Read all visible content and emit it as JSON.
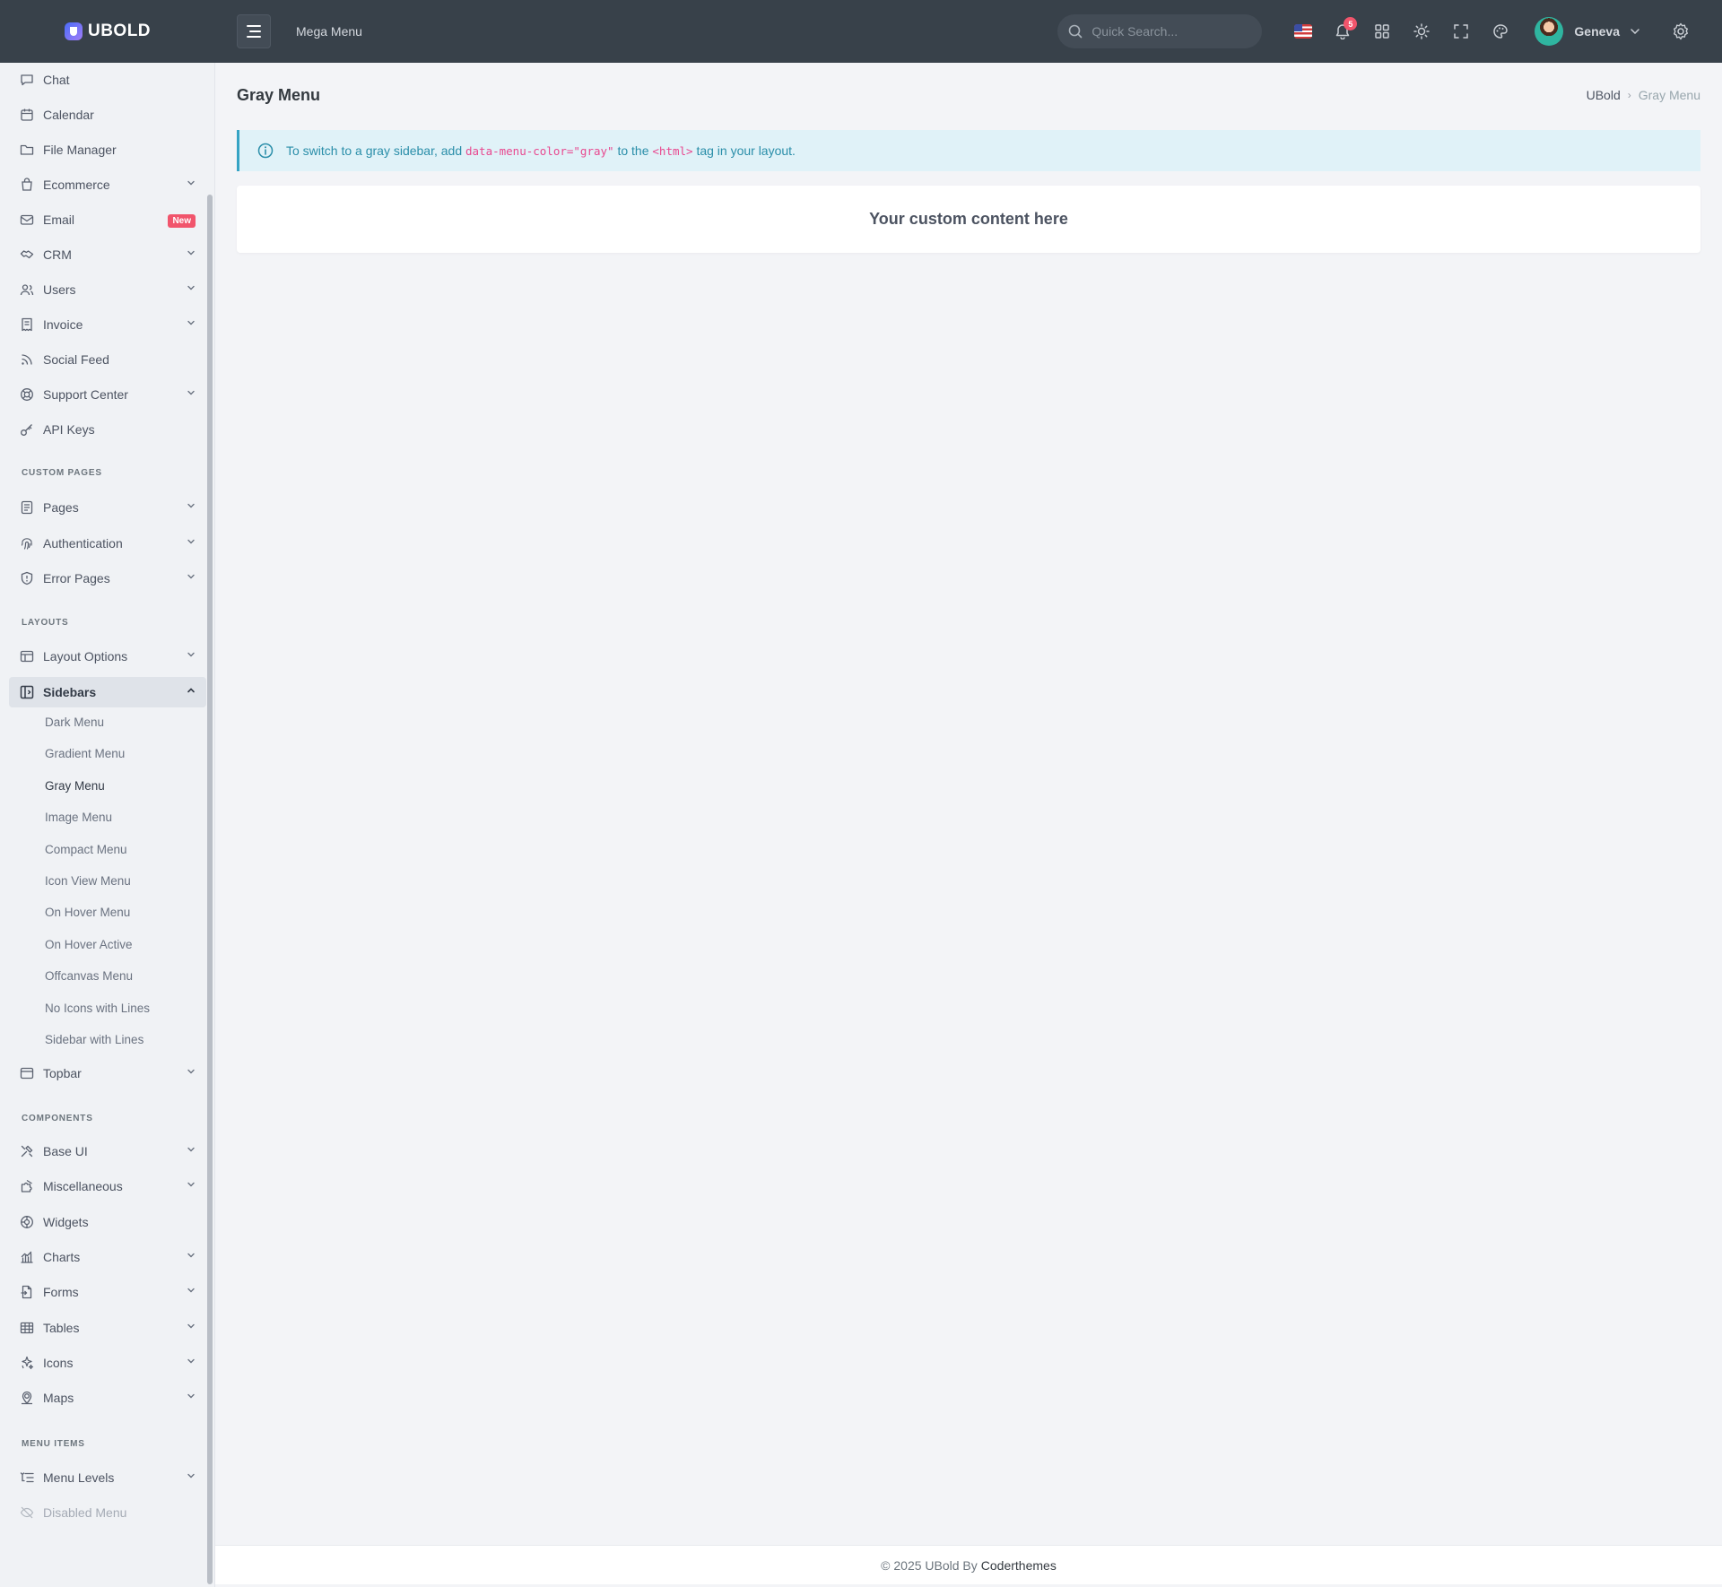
{
  "brand": {
    "name": "UBOLD"
  },
  "topbar": {
    "mega_menu_label": "Mega Menu",
    "search_placeholder": "Quick Search...",
    "notification_count": "5",
    "user_name": "Geneva"
  },
  "sidebar": {
    "items_top": [
      {
        "label": "Chat",
        "icon": "chat-icon"
      },
      {
        "label": "Calendar",
        "icon": "calendar-icon"
      },
      {
        "label": "File Manager",
        "icon": "folder-icon"
      },
      {
        "label": "Ecommerce",
        "icon": "shopping-bag-icon",
        "has_children": true
      },
      {
        "label": "Email",
        "icon": "mail-icon",
        "badge": "New"
      },
      {
        "label": "CRM",
        "icon": "handshake-icon",
        "has_children": true
      },
      {
        "label": "Users",
        "icon": "users-icon",
        "has_children": true
      },
      {
        "label": "Invoice",
        "icon": "invoice-icon",
        "has_children": true
      },
      {
        "label": "Social Feed",
        "icon": "rss-icon"
      },
      {
        "label": "Support Center",
        "icon": "lifebuoy-icon",
        "has_children": true
      },
      {
        "label": "API Keys",
        "icon": "key-icon"
      }
    ],
    "section_custom_pages": "CUSTOM PAGES",
    "items_custom": [
      {
        "label": "Pages",
        "icon": "file-icon",
        "has_children": true
      },
      {
        "label": "Authentication",
        "icon": "fingerprint-icon",
        "has_children": true
      },
      {
        "label": "Error Pages",
        "icon": "shield-icon",
        "has_children": true
      }
    ],
    "section_layouts": "LAYOUTS",
    "layout_options": "Layout Options",
    "sidebars": "Sidebars",
    "sidebar_submenu": [
      "Dark Menu",
      "Gradient Menu",
      "Gray Menu",
      "Image Menu",
      "Compact Menu",
      "Icon View Menu",
      "On Hover Menu",
      "On Hover Active",
      "Offcanvas Menu",
      "No Icons with Lines",
      "Sidebar with Lines"
    ],
    "current_submenu": "Gray Menu",
    "topbar_item": "Topbar",
    "section_components": "COMPONENTS",
    "items_components": [
      {
        "label": "Base UI",
        "icon": "tools-icon",
        "has_children": true
      },
      {
        "label": "Miscellaneous",
        "icon": "puzzle-icon",
        "has_children": true
      },
      {
        "label": "Widgets",
        "icon": "widget-icon"
      },
      {
        "label": "Charts",
        "icon": "chart-icon",
        "has_children": true
      },
      {
        "label": "Forms",
        "icon": "form-icon",
        "has_children": true
      },
      {
        "label": "Tables",
        "icon": "table-icon",
        "has_children": true
      },
      {
        "label": "Icons",
        "icon": "sparkle-icon",
        "has_children": true
      },
      {
        "label": "Maps",
        "icon": "map-pin-icon",
        "has_children": true
      }
    ],
    "section_menu_items": "MENU ITEMS",
    "menu_levels": "Menu Levels",
    "disabled_menu": "Disabled Menu"
  },
  "page": {
    "title": "Gray Menu",
    "breadcrumb": [
      "UBold",
      "Gray Menu"
    ],
    "alert_prefix": "To switch to a gray sidebar, add",
    "alert_code1": "data-menu-color=\"gray\"",
    "alert_mid": "to the",
    "alert_code2": "<html>",
    "alert_suffix": "tag in your layout.",
    "card_text": "Your custom content here"
  },
  "footer": {
    "text": "© 2025 UBold By",
    "brand": "Coderthemes"
  },
  "colors": {
    "topbar": "#38414a",
    "sidebar": "#f0f2f5",
    "accent_info": "#36a3c4",
    "danger": "#f1556c"
  }
}
